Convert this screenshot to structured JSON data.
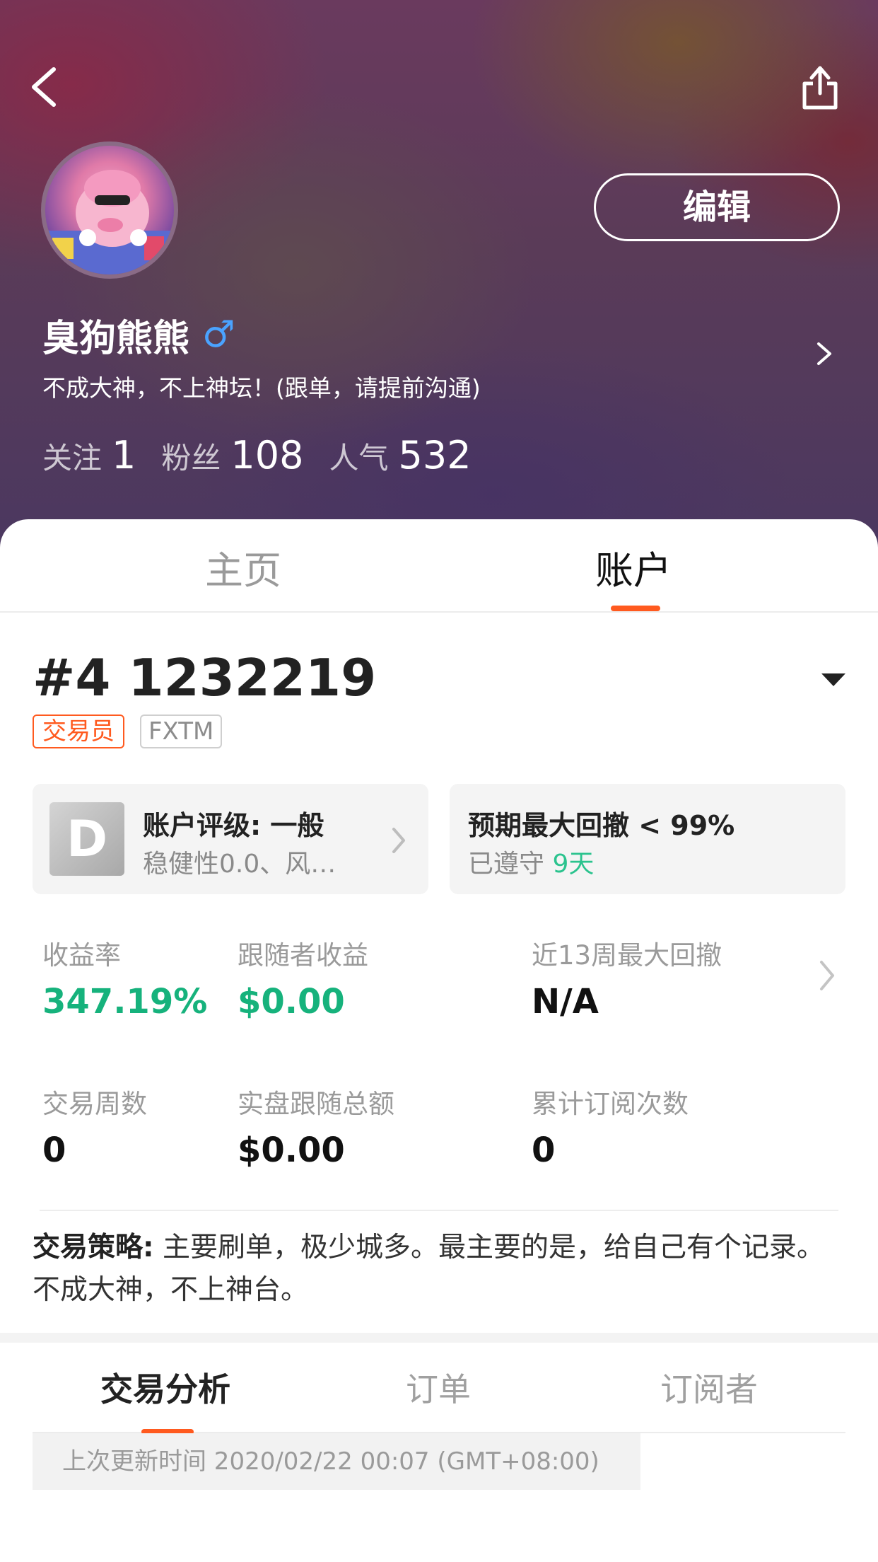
{
  "profile": {
    "nickname": "臭狗熊熊",
    "gender_symbol": "♂",
    "bio": "不成大神，不上神坛！(跟单，请提前沟通)",
    "edit_label": "编辑",
    "stats": [
      {
        "label": "关注",
        "value": "1"
      },
      {
        "label": "粉丝",
        "value": "108"
      },
      {
        "label": "人气",
        "value": "532"
      }
    ]
  },
  "tabs": {
    "home": "主页",
    "account": "账户",
    "active": "account"
  },
  "account": {
    "number": "#4 1232219",
    "tag_role": "交易员",
    "tag_broker": "FXTM",
    "rating": {
      "badge": "D",
      "title": "账户评级: 一般",
      "subtitle": "稳健性0.0、风…"
    },
    "drawdown": {
      "title": "预期最大回撤 < 99%",
      "compliance_prefix": "已遵守",
      "compliance_days": "9天"
    },
    "metrics": [
      {
        "label": "收益率",
        "value": "347.19%"
      },
      {
        "label": "跟随者收益",
        "value": "$0.00"
      },
      {
        "label": "近13周最大回撤",
        "value": "N/A"
      },
      {
        "label": "交易周数",
        "value": "0"
      },
      {
        "label": "实盘跟随总额",
        "value": "$0.00"
      },
      {
        "label": "累计订阅次数",
        "value": "0"
      }
    ],
    "strategy_label": "交易策略:",
    "strategy_text": "主要刷单，极少城多。最主要的是，给自己有个记录。不成大神，不上神台。"
  },
  "sub_tabs": {
    "analysis": "交易分析",
    "orders": "订单",
    "subscribers": "订阅者",
    "active": "analysis"
  },
  "last_update": "上次更新时间 2020/02/22 00:07 (GMT+08:00)",
  "colors": {
    "accent": "#ff5a1f",
    "positive": "#16b27c",
    "days": "#2bc38e",
    "gender": "#4aa3ff"
  },
  "icons": {
    "back": "chevron-left-icon",
    "share": "share-icon",
    "profile_arrow": "chevron-right-icon",
    "dropdown": "caret-down-icon"
  }
}
